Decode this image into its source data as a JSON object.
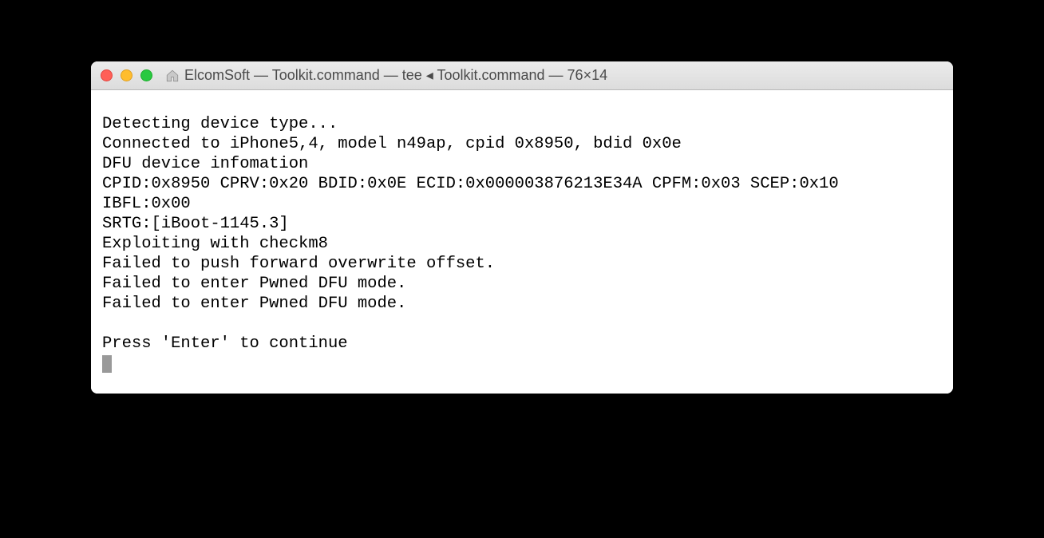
{
  "window": {
    "title": "ElcomSoft — Toolkit.command — tee ◂ Toolkit.command — 76×14"
  },
  "terminal": {
    "lines": [
      "Detecting device type...",
      "Connected to iPhone5,4, model n49ap, cpid 0x8950, bdid 0x0e",
      "DFU device infomation",
      "CPID:0x8950 CPRV:0x20 BDID:0x0E ECID:0x000003876213E34A CPFM:0x03 SCEP:0x10",
      "IBFL:0x00",
      "SRTG:[iBoot-1145.3]",
      "Exploiting with checkm8",
      "Failed to push forward overwrite offset.",
      "Failed to enter Pwned DFU mode.",
      "Failed to enter Pwned DFU mode.",
      "",
      "Press 'Enter' to continue"
    ]
  }
}
